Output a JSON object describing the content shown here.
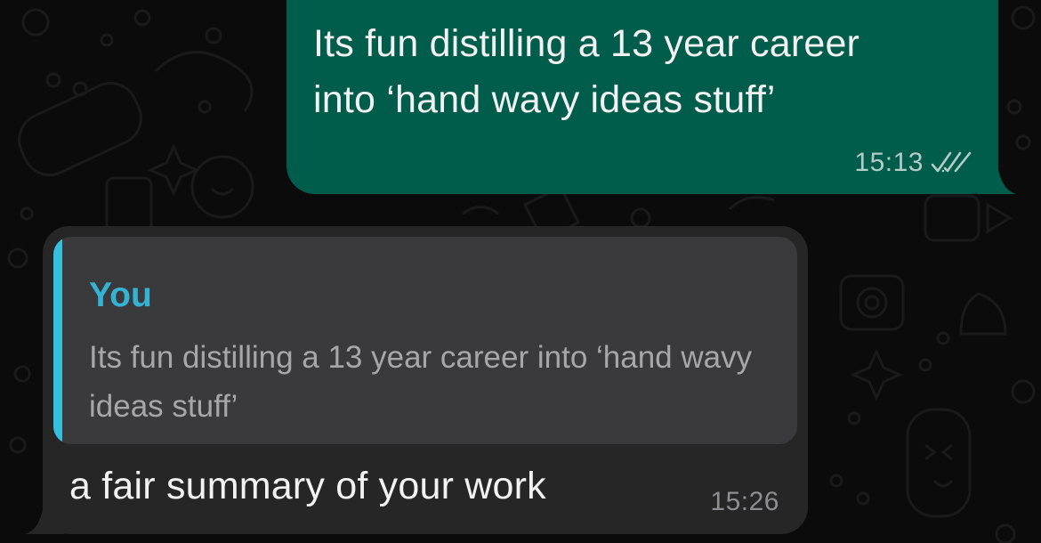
{
  "chat": {
    "messages": [
      {
        "direction": "outgoing",
        "text": "Its fun distilling a 13 year career\ninto ‘hand wavy ideas stuff’",
        "time": "15:13",
        "status_icon": "double-check-icon"
      },
      {
        "direction": "incoming",
        "reply_to": {
          "author": "You",
          "text": "Its fun distilling a 13 year career into ‘hand wavy ideas stuff’"
        },
        "text": "a fair summary of your work",
        "time": "15:26"
      }
    ]
  },
  "colors": {
    "background": "#0b0b0b",
    "outgoing_bubble": "#005c4b",
    "incoming_bubble": "#262626",
    "quote_box": "#3a3a3c",
    "quote_accent": "#35c0e0"
  }
}
